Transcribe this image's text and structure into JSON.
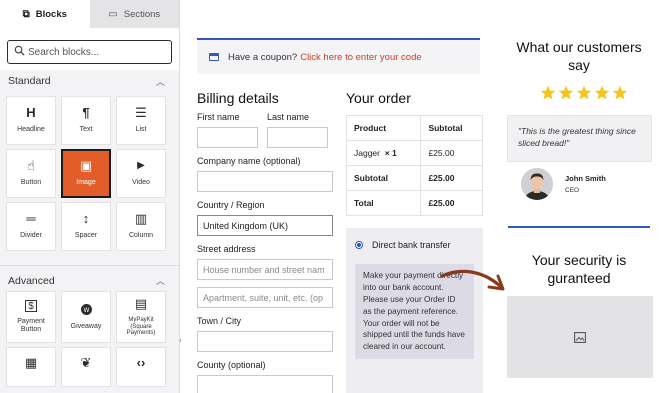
{
  "sidebar": {
    "tabs": [
      {
        "label": "Blocks",
        "icon": "blocks-icon",
        "active": true
      },
      {
        "label": "Sections",
        "icon": "sections-icon",
        "active": false
      }
    ],
    "search": {
      "placeholder": "Search blocks..."
    },
    "standard": {
      "title": "Standard",
      "blocks": [
        {
          "label": "Headline",
          "icon": "H"
        },
        {
          "label": "Text",
          "icon": "¶"
        },
        {
          "label": "List",
          "icon": "☰"
        },
        {
          "label": "Button",
          "icon": "☝"
        },
        {
          "label": "Image",
          "icon": "▣",
          "selected": true
        },
        {
          "label": "Video",
          "icon": "▶"
        },
        {
          "label": "Divider",
          "icon": "═"
        },
        {
          "label": "Spacer",
          "icon": "↕"
        },
        {
          "label": "Column",
          "icon": "▥"
        }
      ]
    },
    "advanced": {
      "title": "Advanced",
      "blocks": [
        {
          "label": "Payment Button",
          "icon": "$"
        },
        {
          "label": "Giveaway",
          "icon": "🏆"
        },
        {
          "label": "MyPayKit (Square Payments)",
          "icon": "▤"
        },
        {
          "label": "",
          "icon": "▦"
        },
        {
          "label": "",
          "icon": "❦"
        },
        {
          "label": "",
          "icon": "‹›"
        }
      ]
    }
  },
  "main": {
    "coupon": {
      "text": "Have a coupon?",
      "link": "Click here to enter your code"
    },
    "billing": {
      "title": "Billing details",
      "first_name": {
        "label": "First name",
        "value": ""
      },
      "last_name": {
        "label": "Last name",
        "value": ""
      },
      "company": {
        "label": "Company name (optional)",
        "value": ""
      },
      "country": {
        "label": "Country / Region",
        "value": "United Kingdom (UK)"
      },
      "street": {
        "label": "Street address",
        "placeholder1": "House number and street nam",
        "placeholder2": "Apartment, suite, unit, etc. (op"
      },
      "town": {
        "label": "Town / City",
        "value": ""
      },
      "county": {
        "label": "County (optional)",
        "value": ""
      }
    },
    "order": {
      "title": "Your order",
      "headers": [
        "Product",
        "Subtotal"
      ],
      "rows": [
        {
          "product": "Jagger",
          "qty": "× 1",
          "subtotal": "£25.00"
        },
        {
          "product": "Subtotal",
          "subtotal": "£25.00"
        },
        {
          "product": "Total",
          "subtotal": "£25.00"
        }
      ],
      "payment": {
        "option": "Direct bank transfer",
        "description": "Make your payment directly into our bank account. Please use your Order ID as the payment reference. Your order will not be shipped until the funds have cleared in our account."
      }
    }
  },
  "right": {
    "testimonial_title": "What our customers say",
    "rating": 5,
    "quote": "\"This is the greatest thing since sliced bread!\"",
    "author_name": "John Smith",
    "author_role": "CEO",
    "security_title": "Your security is guranteed"
  },
  "colors": {
    "accent": "#2f58c4",
    "selected_block": "#e35d2a",
    "link": "#d63a1d",
    "star": "#f5c518"
  }
}
